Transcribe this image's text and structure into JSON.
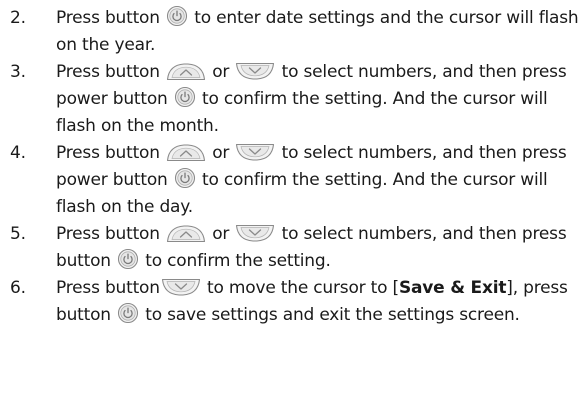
{
  "steps": [
    {
      "number": "2.",
      "parts": [
        {
          "t": "text",
          "v": "Press button "
        },
        {
          "t": "icon",
          "name": "power-button-icon"
        },
        {
          "t": "text",
          "v": " to enter date settings and the cursor will flash on the year."
        }
      ]
    },
    {
      "number": "3.",
      "parts": [
        {
          "t": "text",
          "v": "Press button "
        },
        {
          "t": "icon",
          "name": "up-button-icon"
        },
        {
          "t": "text",
          "v": " or "
        },
        {
          "t": "icon",
          "name": "down-button-icon"
        },
        {
          "t": "text",
          "v": " to select numbers, and then press power button "
        },
        {
          "t": "icon",
          "name": "power-button-icon"
        },
        {
          "t": "text",
          "v": " to confirm the setting. And the cursor will flash on the month."
        }
      ]
    },
    {
      "number": "4.",
      "parts": [
        {
          "t": "text",
          "v": "Press button "
        },
        {
          "t": "icon",
          "name": "up-button-icon"
        },
        {
          "t": "text",
          "v": " or "
        },
        {
          "t": "icon",
          "name": "down-button-icon"
        },
        {
          "t": "text",
          "v": " to select numbers, and then press power button "
        },
        {
          "t": "icon",
          "name": "power-button-icon"
        },
        {
          "t": "text",
          "v": " to confirm the setting. And the cursor will flash on the day."
        }
      ]
    },
    {
      "number": "5.",
      "parts": [
        {
          "t": "text",
          "v": "Press button "
        },
        {
          "t": "icon",
          "name": "up-button-icon"
        },
        {
          "t": "text",
          "v": " or "
        },
        {
          "t": "icon",
          "name": "down-button-icon"
        },
        {
          "t": "text",
          "v": " to select numbers, and then press button "
        },
        {
          "t": "icon",
          "name": "power-button-icon"
        },
        {
          "t": "text",
          "v": " to confirm the setting."
        }
      ]
    },
    {
      "number": "6.",
      "parts": [
        {
          "t": "text",
          "v": "Press button"
        },
        {
          "t": "icon",
          "name": "down-button-icon"
        },
        {
          "t": "text",
          "v": " to move the cursor to ["
        },
        {
          "t": "bold",
          "v": "Save & Exit"
        },
        {
          "t": "text",
          "v": "], press button "
        },
        {
          "t": "icon",
          "name": "power-button-icon"
        },
        {
          "t": "text",
          "v": " to save settings and exit the settings screen."
        }
      ]
    }
  ],
  "colors": {
    "text": "#1a1a1a",
    "icon_outline": "#8a8a8a",
    "icon_fill": "#ececec"
  }
}
